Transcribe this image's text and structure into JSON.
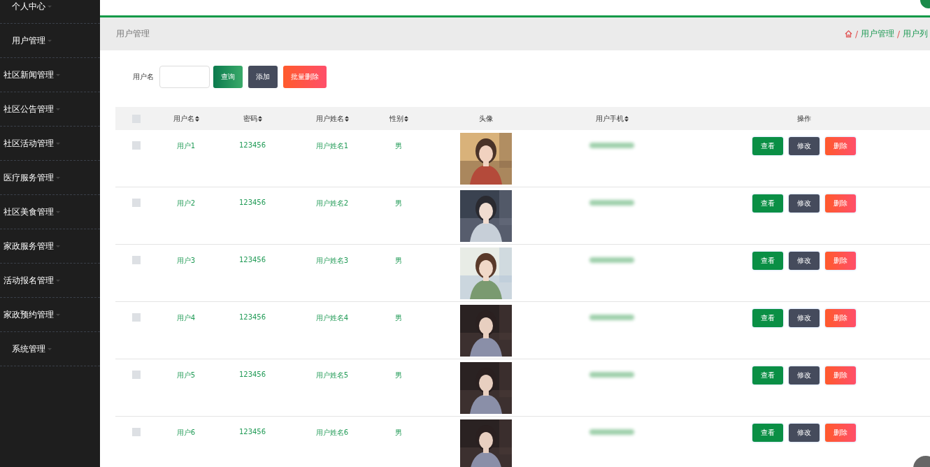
{
  "sidebar": {
    "items": [
      {
        "label": "个人中心"
      },
      {
        "label": "用户管理"
      },
      {
        "label": "社区新闻管理"
      },
      {
        "label": "社区公告管理"
      },
      {
        "label": "社区活动管理"
      },
      {
        "label": "医疗服务管理"
      },
      {
        "label": "社区美食管理"
      },
      {
        "label": "家政服务管理"
      },
      {
        "label": "活动报名管理"
      },
      {
        "label": "家政预约管理"
      },
      {
        "label": "系统管理"
      }
    ]
  },
  "breadcrumb": {
    "title": "用户管理",
    "crumbs": [
      {
        "separator": "/",
        "label": "用户管理"
      },
      {
        "separator": "/",
        "label": "用户列"
      }
    ]
  },
  "search": {
    "label": "用户名",
    "buttons": [
      {
        "label": "查询",
        "kind": "query"
      },
      {
        "label": "添加",
        "kind": "add"
      },
      {
        "label": "批量删除",
        "kind": "delete"
      }
    ]
  },
  "table": {
    "all_checked": false,
    "columns": [
      {
        "label": "用户名",
        "sortable": true
      },
      {
        "label": "密码",
        "sortable": true
      },
      {
        "label": "用户姓名",
        "sortable": true
      },
      {
        "label": "性别",
        "sortable": true
      },
      {
        "label": "头像",
        "sortable": false
      },
      {
        "label": "用户手机",
        "sortable": true
      },
      {
        "label": "操作",
        "sortable": false
      }
    ],
    "rows": [
      {
        "checked": false,
        "username": "用户1",
        "password": "123456",
        "name": "用户姓名1",
        "gender": "男",
        "actions": [
          {
            "label": "查看",
            "kind": "view"
          },
          {
            "label": "修改",
            "kind": "edit"
          },
          {
            "label": "删除",
            "kind": "delete"
          }
        ]
      },
      {
        "checked": false,
        "username": "用户2",
        "password": "123456",
        "name": "用户姓名2",
        "gender": "男",
        "actions": [
          {
            "label": "查看",
            "kind": "view"
          },
          {
            "label": "修改",
            "kind": "edit"
          },
          {
            "label": "删除",
            "kind": "delete"
          }
        ]
      },
      {
        "checked": false,
        "username": "用户3",
        "password": "123456",
        "name": "用户姓名3",
        "gender": "男",
        "actions": [
          {
            "label": "查看",
            "kind": "view"
          },
          {
            "label": "修改",
            "kind": "edit"
          },
          {
            "label": "删除",
            "kind": "delete"
          }
        ]
      },
      {
        "checked": false,
        "username": "用户4",
        "password": "123456",
        "name": "用户姓名4",
        "gender": "男",
        "actions": [
          {
            "label": "查看",
            "kind": "view"
          },
          {
            "label": "修改",
            "kind": "edit"
          },
          {
            "label": "删除",
            "kind": "delete"
          }
        ]
      },
      {
        "checked": false,
        "username": "用户5",
        "password": "123456",
        "name": "用户姓名5",
        "gender": "男",
        "actions": [
          {
            "label": "查看",
            "kind": "view"
          },
          {
            "label": "修改",
            "kind": "edit"
          },
          {
            "label": "删除",
            "kind": "delete"
          }
        ]
      },
      {
        "checked": false,
        "username": "用户6",
        "password": "123456",
        "name": "用户姓名6",
        "gender": "男",
        "actions": [
          {
            "label": "查看",
            "kind": "view"
          },
          {
            "label": "修改",
            "kind": "edit"
          },
          {
            "label": "删除",
            "kind": "delete"
          }
        ]
      }
    ]
  }
}
